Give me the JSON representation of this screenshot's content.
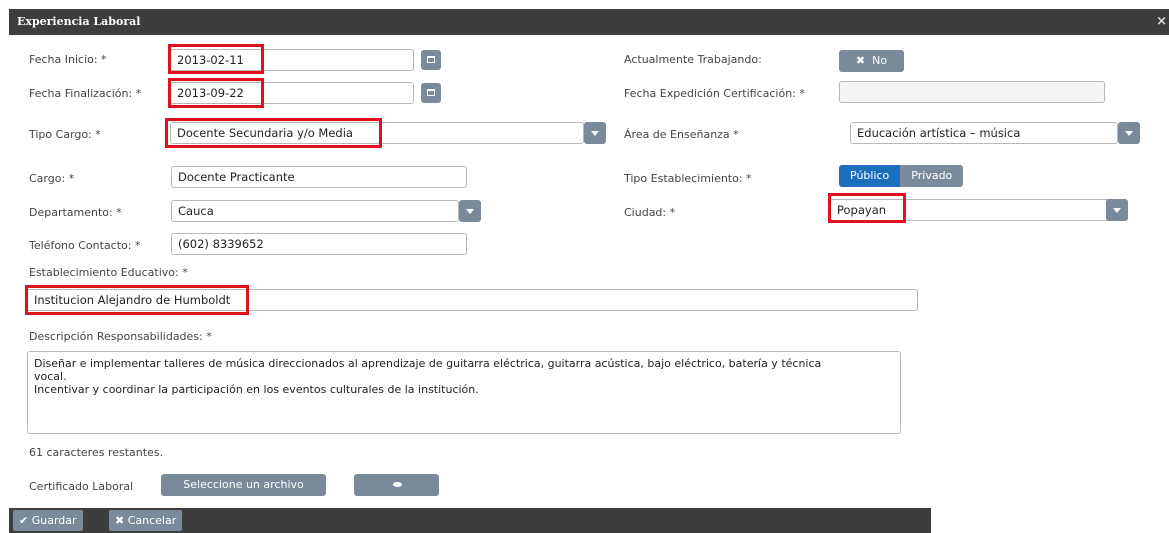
{
  "dialog": {
    "title": "Experiencia Laboral",
    "close_symbol": "×"
  },
  "form": {
    "fecha_inicio": {
      "label": "Fecha Inicio: *",
      "value": "2013-02-11"
    },
    "fecha_finalizacion": {
      "label": "Fecha Finalización: *",
      "value": "2013-09-22"
    },
    "actualmente_trabajando": {
      "label": "Actualmente Trabajando:",
      "value": "No",
      "icon": "✖"
    },
    "fecha_expedicion": {
      "label": "Fecha Expedición Certificación: *",
      "value": ""
    },
    "tipo_cargo": {
      "label": "Tipo Cargo: *",
      "value": "Docente Secundaria y/o Media"
    },
    "area_ensenanza": {
      "label": "Área de Enseñanza *",
      "value": "Educación artística – música"
    },
    "cargo": {
      "label": "Cargo: *",
      "value": "Docente Practicante"
    },
    "tipo_establecimiento": {
      "label": "Tipo Establecimiento: *",
      "options": [
        "Público",
        "Privado"
      ],
      "selected": "Público"
    },
    "departamento": {
      "label": "Departamento: *",
      "value": "Cauca"
    },
    "ciudad": {
      "label": "Ciudad: *",
      "value": "Popayan"
    },
    "telefono": {
      "label": "Teléfono Contacto: *",
      "value": "(602) 8339652"
    },
    "establecimiento": {
      "label": "Establecimiento Educativo: *",
      "value": "Institucion Alejandro de Humboldt"
    },
    "descripcion": {
      "label": "Descripción Responsabilidades: *",
      "value": "Diseñar e implementar talleres de música direccionados al aprendizaje de guitarra eléctrica, guitarra acústica, bajo eléctrico, batería y técnica\nvocal.\nIncentivar y coordinar la participación en los eventos culturales de la institución.",
      "remaining": "61 caracteres restantes."
    },
    "certificado": {
      "label": "Certificado Laboral",
      "button": "Seleccione un archivo"
    }
  },
  "footer": {
    "save": "Guardar",
    "save_icon": "✔",
    "cancel": "Cancelar",
    "cancel_icon": "✖"
  },
  "colors": {
    "highlight": "#e0101c",
    "accent_blue": "#1b6fbd",
    "button_gray": "#7b8a9b",
    "titlebar": "#3d3d3d"
  }
}
